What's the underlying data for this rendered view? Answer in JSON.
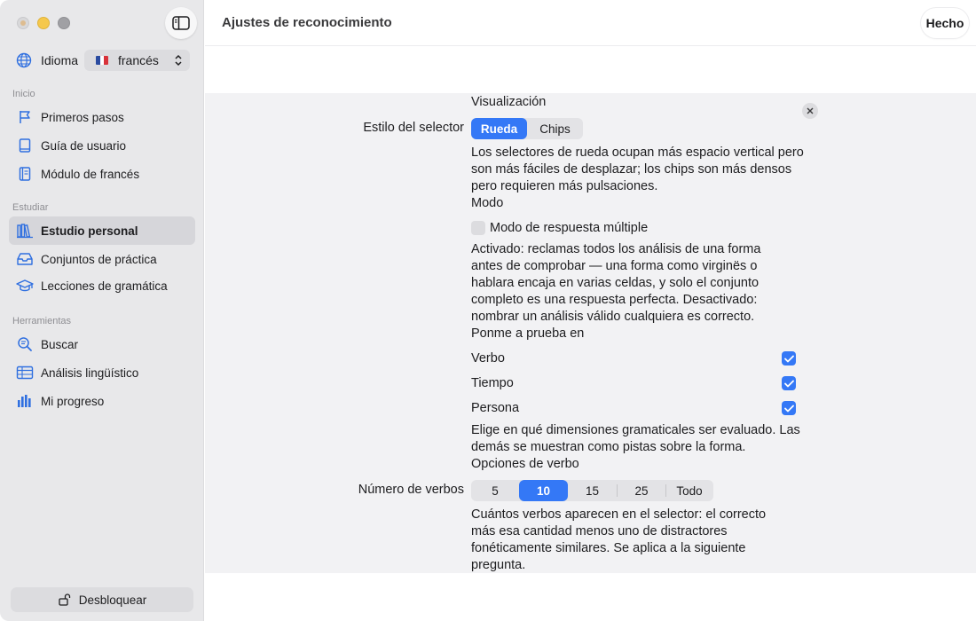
{
  "sidebar": {
    "language_label": "Idioma",
    "language_value": "francés",
    "sections": [
      {
        "title": "Inicio",
        "items": [
          {
            "label": "Primeros pasos",
            "icon": "flag-icon"
          },
          {
            "label": "Guía de usuario",
            "icon": "book-icon"
          },
          {
            "label": "Módulo de francés",
            "icon": "notebook-icon"
          }
        ]
      },
      {
        "title": "Estudiar",
        "items": [
          {
            "label": "Estudio personal",
            "icon": "books-icon",
            "active": true
          },
          {
            "label": "Conjuntos de práctica",
            "icon": "tray-icon"
          },
          {
            "label": "Lecciones de gramática",
            "icon": "graduation-cap-icon"
          }
        ]
      },
      {
        "title": "Herramientas",
        "items": [
          {
            "label": "Buscar",
            "icon": "magnifier-icon"
          },
          {
            "label": "Análisis lingüístico",
            "icon": "table-icon"
          },
          {
            "label": "Mi progreso",
            "icon": "bar-chart-icon"
          }
        ]
      }
    ],
    "unlock_label": "Desbloquear"
  },
  "header": {
    "title": "Ajustes de reconocimiento",
    "done_label": "Hecho"
  },
  "settings": {
    "display_section": "Visualización",
    "selector_style_label": "Estilo del selector",
    "selector_style_options": [
      "Rueda",
      "Chips"
    ],
    "selector_style_selected": "Rueda",
    "selector_style_help": [
      "Los selectores de rueda ocupan más espacio vertical pero",
      "son más fáciles de desplazar; los chips son más densos",
      "pero requieren más pulsaciones."
    ],
    "mode_section": "Modo",
    "multi_answer_label": "Modo de respuesta múltiple",
    "multi_answer_checked": false,
    "multi_answer_help": [
      "Activado: reclamas todos los análisis de una forma",
      "antes de comprobar — una forma como virginës o",
      "hablara encaja en varias celdas, y solo el conjunto",
      "completo es una respuesta perfecta. Desactivado:",
      "nombrar un análisis válido cualquiera es correcto."
    ],
    "test_section": "Ponme a prueba en",
    "test_items": [
      {
        "label": "Verbo",
        "checked": true
      },
      {
        "label": "Tiempo",
        "checked": true
      },
      {
        "label": "Persona",
        "checked": true
      }
    ],
    "test_help": [
      "Elige en qué dimensiones gramaticales ser evaluado. Las",
      "demás se muestran como pistas sobre la forma."
    ],
    "verb_options_section": "Opciones de verbo",
    "verb_count_label": "Número de verbos",
    "verb_count_options": [
      "5",
      "10",
      "15",
      "25",
      "Todo"
    ],
    "verb_count_selected": "10",
    "verb_count_help": [
      "Cuántos verbos aparecen en el selector: el correcto",
      "más esa cantidad menos uno de distractores",
      "fonéticamente similares. Se aplica a la siguiente",
      "pregunta."
    ]
  },
  "colors": {
    "accent": "#3478f6",
    "sidebar_bg": "#e8e8ea",
    "sheet_bg": "#f2f2f4"
  }
}
